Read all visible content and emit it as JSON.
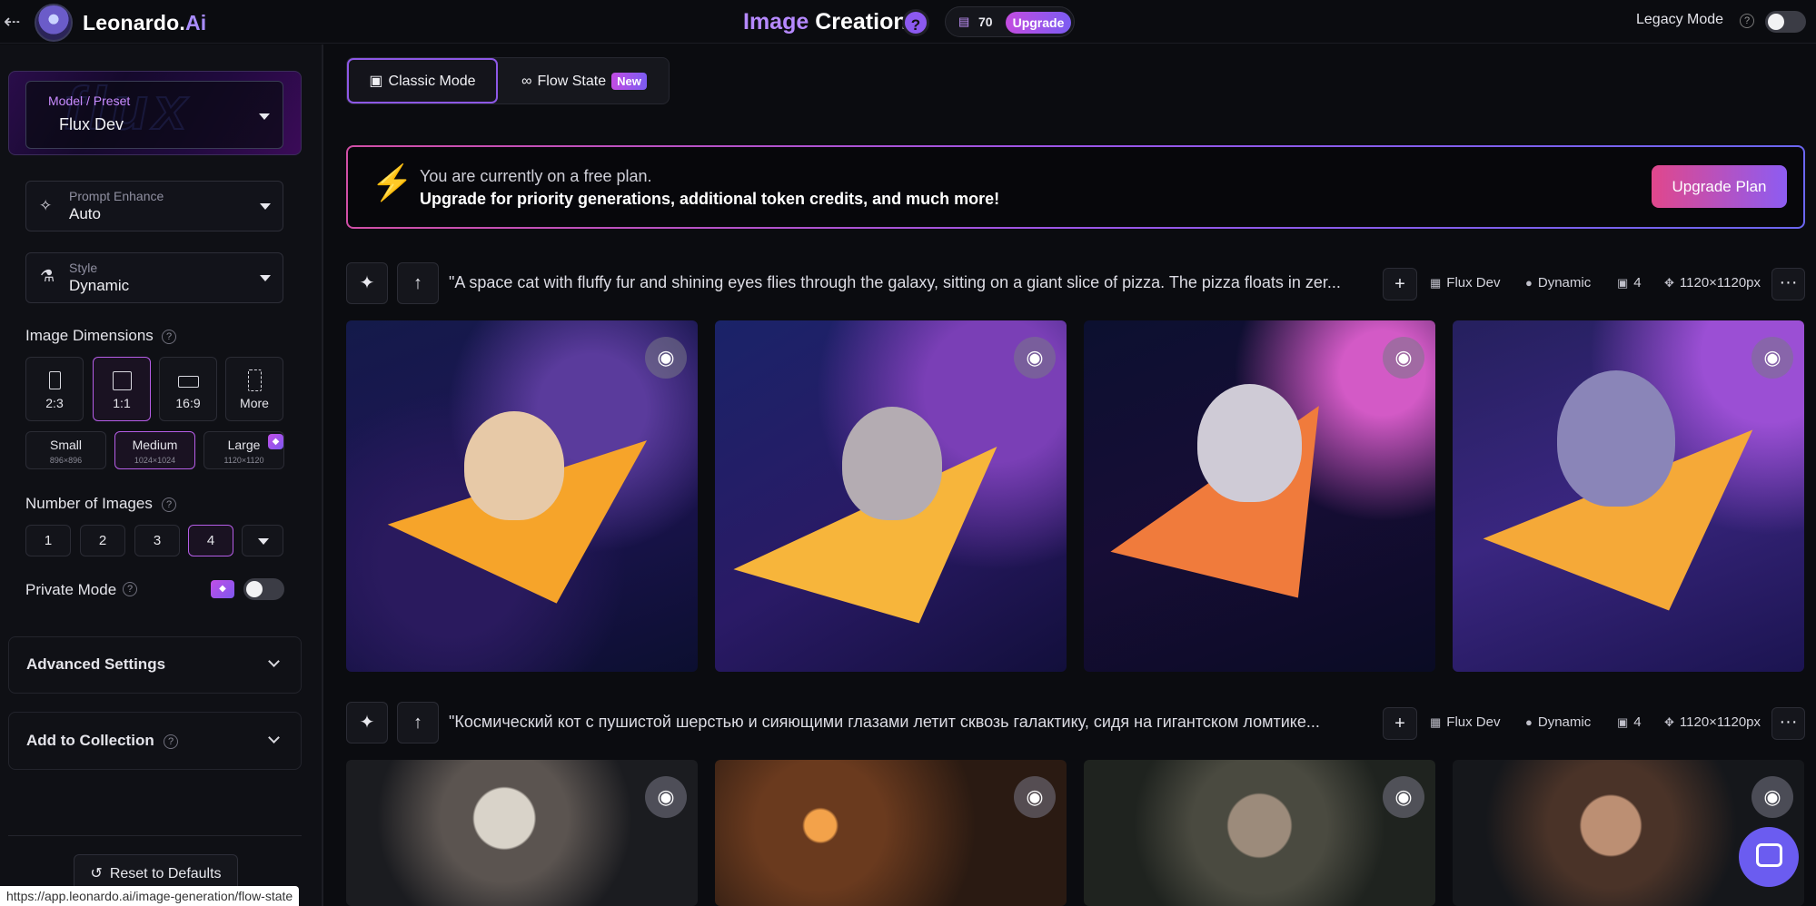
{
  "app": {
    "name_main": "Leonardo.",
    "name_accent": "Ai"
  },
  "header": {
    "title_part1": "Image",
    "title_part2": "Creation",
    "help": "?",
    "tokens": "70",
    "upgrade_label": "Upgrade",
    "legacy_label": "Legacy Mode",
    "legacy_q": "?"
  },
  "sidebar": {
    "model_label": "Model / Preset",
    "model_value": "Flux Dev",
    "model_art_text": "flux",
    "prompt_enhance_label": "Prompt Enhance",
    "prompt_enhance_value": "Auto",
    "style_label": "Style",
    "style_value": "Dynamic",
    "dimensions_title": "Image Dimensions",
    "ratios": [
      "2:3",
      "1:1",
      "16:9",
      "More"
    ],
    "sizes": [
      {
        "label": "Small",
        "sub": "896×896"
      },
      {
        "label": "Medium",
        "sub": "1024×1024"
      },
      {
        "label": "Large",
        "sub": "1120×1120"
      }
    ],
    "num_images_title": "Number of Images",
    "num_options": [
      "1",
      "2",
      "3",
      "4"
    ],
    "private_mode": "Private Mode",
    "advanced_settings": "Advanced Settings",
    "add_to_collection": "Add to Collection",
    "reset": "Reset to Defaults",
    "q": "?"
  },
  "modes": {
    "classic": "Classic Mode",
    "flow": "Flow State",
    "new_badge": "New"
  },
  "banner": {
    "line1": "You are currently on a free plan.",
    "line2": "Upgrade for priority generations, additional token credits, and much more!",
    "button": "Upgrade Plan"
  },
  "generations": [
    {
      "prompt": "\"A space cat with fluffy fur and shining eyes flies through the galaxy, sitting on a giant slice of pizza. The pizza floats in zer...",
      "model": "Flux Dev",
      "style": "Dynamic",
      "count": "4",
      "size": "1120×1120px"
    },
    {
      "prompt": "\"Космический кот с пушистой шерстью и сияющими глазами летит сквозь галактику, сидя на гигантском ломтике...",
      "model": "Flux Dev",
      "style": "Dynamic",
      "count": "4",
      "size": "1120×1120px"
    }
  ],
  "status_url": "https://app.leonardo.ai/image-generation/flow-state",
  "colors": {
    "accent": "#8d58e6",
    "brand_pink": "#e0478c",
    "bg": "#0b0c10"
  }
}
